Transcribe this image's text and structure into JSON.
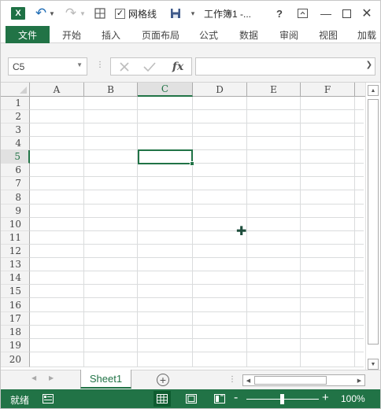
{
  "app": {
    "logo_text": "X",
    "doc_title": "工作簿1 -...",
    "gridlines_label": "网格线",
    "gridlines_checked": true,
    "help_label": "?"
  },
  "ribbon": {
    "tabs": [
      {
        "label": "文件",
        "active": false,
        "file_tab": true
      },
      {
        "label": "开始"
      },
      {
        "label": "插入"
      },
      {
        "label": "页面布局"
      },
      {
        "label": "公式"
      },
      {
        "label": "数据"
      },
      {
        "label": "审阅"
      },
      {
        "label": "视图"
      },
      {
        "label": "加载"
      }
    ]
  },
  "formula_bar": {
    "name_box": "C5",
    "formula": "",
    "fx_label": "fx"
  },
  "grid": {
    "columns": [
      "A",
      "B",
      "C",
      "D",
      "E",
      "F"
    ],
    "rows": [
      "1",
      "2",
      "3",
      "4",
      "5",
      "6",
      "7",
      "8",
      "9",
      "10",
      "11",
      "12",
      "13",
      "14",
      "15",
      "16",
      "17",
      "18",
      "19",
      "20"
    ],
    "selected_column": "C",
    "selected_row": "5",
    "active_cell": "C5"
  },
  "sheets": {
    "tabs": [
      "Sheet1"
    ],
    "active": "Sheet1"
  },
  "status": {
    "ready_text": "就绪",
    "zoom_level": "100%",
    "active_view": "normal"
  },
  "colors": {
    "accent": "#217346",
    "status_bar": "#217346",
    "undo_icon": "#1e6cb5"
  }
}
